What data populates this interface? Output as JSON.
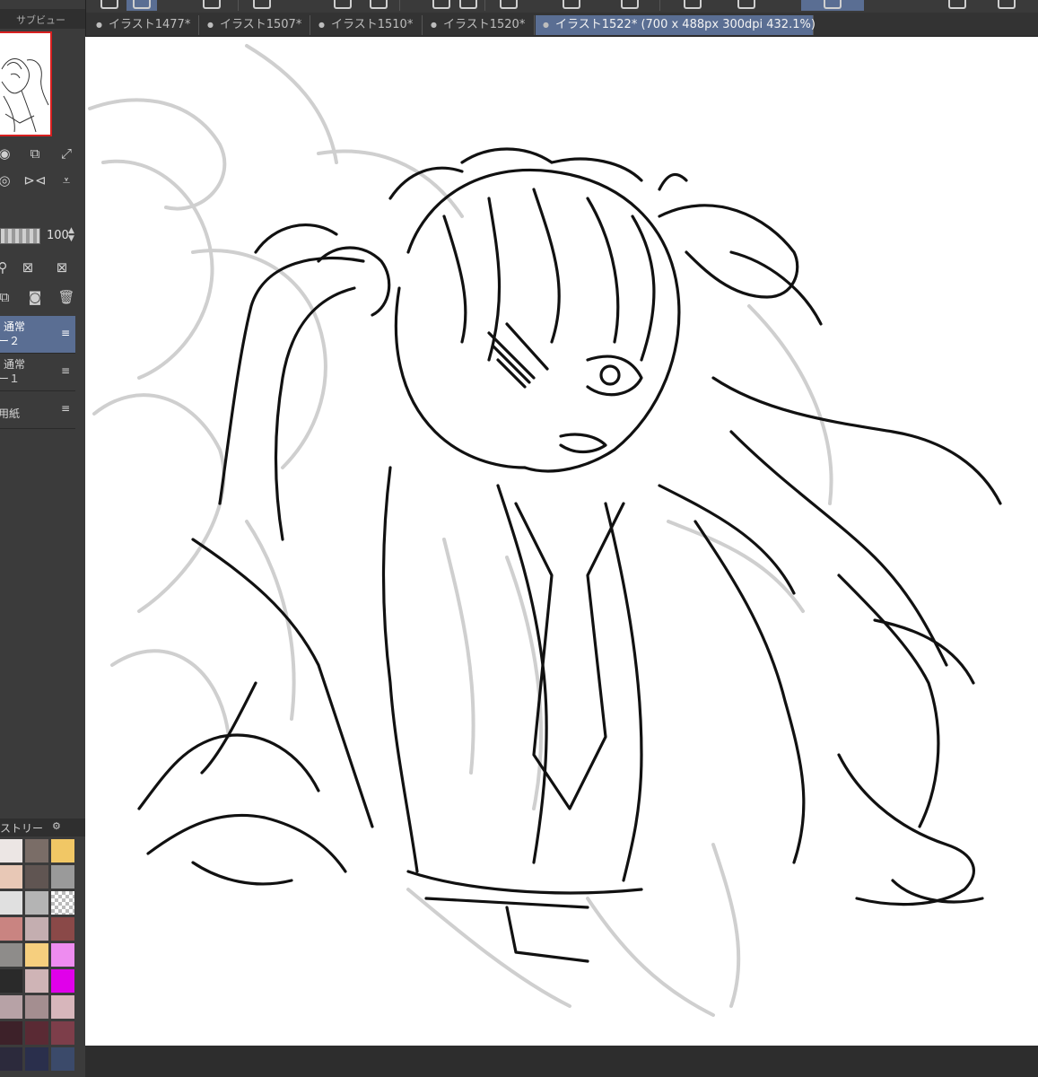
{
  "tabs": [
    {
      "label": "イラスト1477*"
    },
    {
      "label": "イラスト1507*"
    },
    {
      "label": "イラスト1510*"
    },
    {
      "label": "イラスト1520*"
    },
    {
      "label": "イラスト1522* (700 x 488px 300dpi 432.1%)"
    }
  ],
  "subview": {
    "title": "サブビュー"
  },
  "layer_panel": {
    "opacity_value": "100",
    "layers": [
      {
        "blend": "通常",
        "name": "ー２"
      },
      {
        "blend": "通常",
        "name": "ー１"
      },
      {
        "blend": "",
        "name": "用紙"
      }
    ]
  },
  "palette": {
    "title": "ストリー",
    "colors": [
      "#ece6e4",
      "#7a6d67",
      "#f1c765",
      "#e8c8b6",
      "#605552",
      "#9a9a9a",
      "#e0e0e0",
      "#b4b4b4",
      "checker",
      "#c98481",
      "#c4aeb0",
      "#8a4948",
      "#8e8c8a",
      "#f6cf7e",
      "#ee8cf0",
      "#2a2a2a",
      "#cfb4b6",
      "#e000ea",
      "#b7a2a6",
      "#a48e90",
      "#d7b6bb",
      "#3d2129",
      "#5a2a34",
      "#7d3e4a",
      "#2c2a3c",
      "#2a2f4c",
      "#3b4a6a"
    ]
  },
  "icons": [
    "rotate-icon",
    "copy-transform-icon",
    "expand-icon",
    "flip-horizontal-icon",
    "flip-vertical-icon",
    "clipping-icon",
    "lock-icon",
    "new-layer-icon",
    "mask-icon",
    "trash-icon",
    "layer-menu-icon"
  ]
}
